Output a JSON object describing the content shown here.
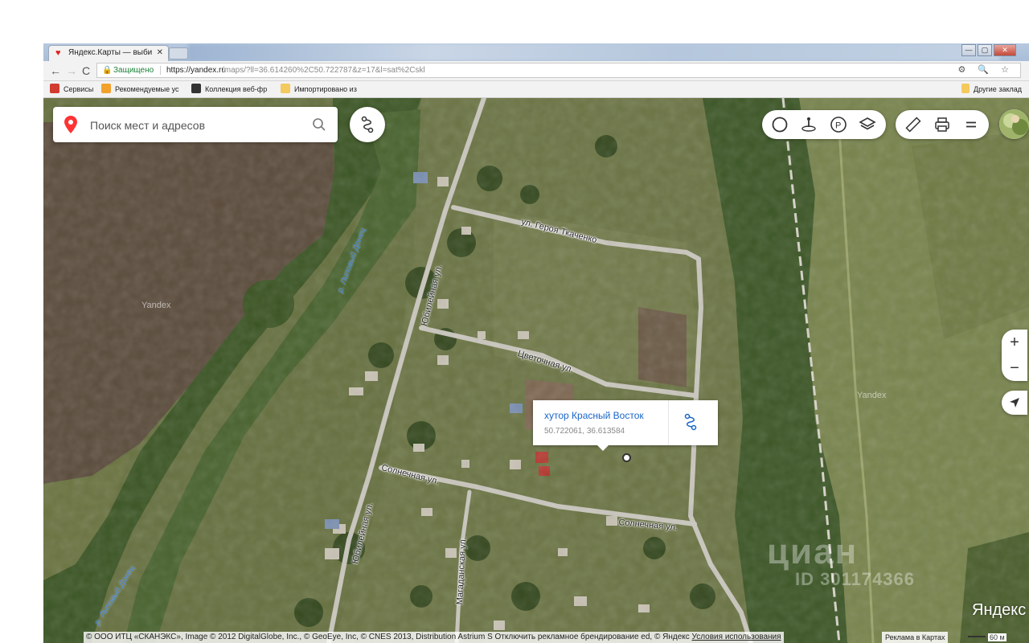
{
  "browser": {
    "tab_title": "Яндекс.Карты — выбирг",
    "tab_close": "✕",
    "nav": {
      "back": "←",
      "forward": "→",
      "reload": "C"
    },
    "address": {
      "secure_label": "Защищено",
      "url_host": "https://yandex.ru",
      "url_rest": "/maps/?ll=36.614260%2C50.722787&z=17&l=sat%2Cskl",
      "icons": "⚙ 🔍 ☆"
    },
    "window_buttons": {
      "minimize": "—",
      "maximize": "▢",
      "close": "✕"
    },
    "bookmarks": [
      {
        "label": "Сервисы",
        "icon": "apps-grid",
        "color": "#d23b2f"
      },
      {
        "label": "Рекомендуемые ус",
        "icon": "bookmark",
        "color": "#f2a12c"
      },
      {
        "label": "Коллекция веб-фр",
        "icon": "bookmark",
        "color": "#333333"
      },
      {
        "label": "Импортировано из",
        "icon": "folder",
        "color": "#f4c95d"
      }
    ],
    "other_bookmarks": "Другие заклад"
  },
  "map": {
    "search": {
      "placeholder": "Поиск мест и адресов"
    },
    "controls": {
      "traffic": "traffic-icon",
      "panorama": "panorama-icon",
      "parking": "parking-icon",
      "layers": "layers-icon",
      "ruler": "ruler-icon",
      "print": "print-icon",
      "menu": "menu-icon",
      "zoom_in": "+",
      "zoom_out": "−"
    },
    "popup": {
      "title": "хутор Красный Восток",
      "coordinates": "50.722061, 36.613584"
    },
    "street_labels": {
      "geroya": "ул. Героя Ткаченко",
      "yubileynaya_top": "Юбилейная ул.",
      "tsvetochnaya": "Цветочная ул.",
      "solnechnaya_left": "Солнечная ул.",
      "solnechnaya_right": "Солнечная ул.",
      "yubileynaya_bottom": "Юбилейная ул.",
      "magadanskaya": "Магаданская ул."
    },
    "river_labels": {
      "top": "р. Липовый Донец",
      "bottom": "р. Липовый Донец"
    },
    "watermarks": {
      "yandex_1": "Yandex",
      "yandex_2": "Yandex",
      "cian": "циан",
      "cian_id": "ID 301174366"
    },
    "logo": "Яндекс",
    "copyright": {
      "text": "© ООО ИТЦ «СКАНЭКС», Image © 2012 DigitalGlobe, Inc., © GeoEye, Inc, © CNES 2013, Distribution Astrium S",
      "disable_ads": "Отключить рекламное брендирование",
      "ed": "ed,",
      "yandex": "© Яндекс",
      "terms": "Условия использования",
      "ads": "Реклама в Картах",
      "scale": "60 м"
    }
  }
}
